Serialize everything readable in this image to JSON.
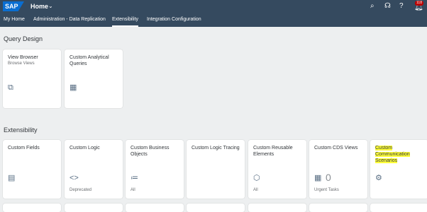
{
  "shell": {
    "logo": "SAP",
    "home": "Home",
    "notification_count": "118",
    "icons": [
      "search-icon",
      "headset-icon",
      "help-icon",
      "bell-icon"
    ]
  },
  "tabs": [
    "My Home",
    "Administration - Data Replication",
    "Extensibility",
    "Integration Configuration"
  ],
  "active_tab": "Extensibility",
  "query_design": {
    "title": "Query Design",
    "tiles": [
      {
        "title": "View Browser",
        "subtitle": "Browse Views",
        "icon": "view-browser-icon"
      },
      {
        "title": "Custom Analytical Queries",
        "icon": "table-gear-icon"
      }
    ]
  },
  "extensibility": {
    "title": "Extensibility",
    "tiles": [
      {
        "title": "Custom Fields",
        "icon": "custom-fields-icon"
      },
      {
        "title": "Custom Logic",
        "icon": "code-icon",
        "footer": "Deprecated"
      },
      {
        "title": "Custom Business Objects",
        "icon": "business-objects-icon",
        "footer": "All"
      },
      {
        "title": "Custom Logic Tracing"
      },
      {
        "title": "Custom Reusable Elements",
        "icon": "reusable-elements-icon",
        "footer": "All"
      },
      {
        "title": "Custom CDS Views",
        "icon": "table-gear-icon",
        "kpi": "0",
        "footer": "Urgent Tasks"
      },
      {
        "title": "Custom Communication Scenarios",
        "icon": "gear-icon",
        "highlight_color": "#ffff3a"
      }
    ]
  }
}
